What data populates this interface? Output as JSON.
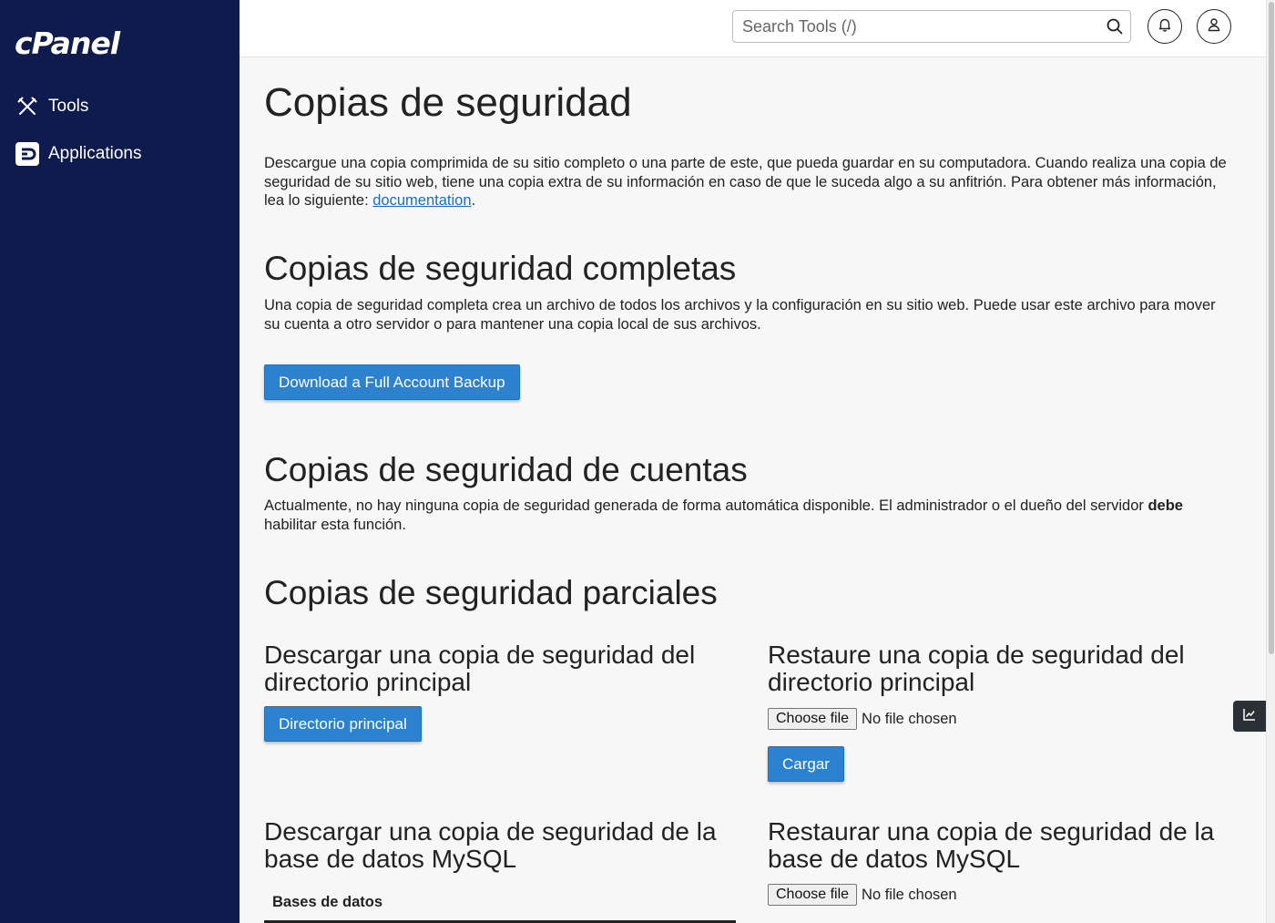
{
  "sidebar": {
    "logo": "cPanel",
    "items": [
      {
        "label": "Tools",
        "icon": "tools-icon"
      },
      {
        "label": "Applications",
        "icon": "applications-icon"
      }
    ]
  },
  "topbar": {
    "search_placeholder": "Search Tools (/)"
  },
  "main": {
    "title": "Copias de seguridad",
    "intro_text": "Descargue una copia comprimida de su sitio completo o una parte de este, que pueda guardar en su computadora. Cuando realiza una copia de seguridad de su sitio web, tiene una copia extra de su información en caso de que le suceda algo a su anfitrión. Para obtener más información, lea lo siguiente: ",
    "intro_link": "documentation",
    "intro_end": ".",
    "full_backup": {
      "heading": "Copias de seguridad completas",
      "text": "Una copia de seguridad completa crea un archivo de todos los archivos y la configuración en su sitio web. Puede usar este archivo para mover su cuenta a otro servidor o para mantener una copia local de sus archivos.",
      "button": "Download a Full Account Backup"
    },
    "account_backups": {
      "heading": "Copias de seguridad de cuentas",
      "text_before": "Actualmente, no hay ninguna copia de seguridad generada de forma automática disponible. El administrador o el dueño del servidor ",
      "text_bold": "debe",
      "text_after": " habilitar esta función."
    },
    "partial_backups": {
      "heading": "Copias de seguridad parciales",
      "download_home_heading": "Descargar una copia de seguridad del directorio principal",
      "download_home_button": "Directorio principal",
      "restore_home_heading": "Restaure una copia de seguridad del directorio principal",
      "choose_file": "Choose file",
      "no_file": "No file chosen",
      "upload_button": "Cargar",
      "download_mysql_heading": "Descargar una copia de seguridad de la base de datos MySQL",
      "databases_column": "Bases de datos",
      "restore_mysql_heading": "Restaurar una copia de seguridad de la base de datos MySQL"
    }
  },
  "colors": {
    "sidebar_bg": "#0f1b4c",
    "accent": "#2d82d0",
    "link": "#1b6fc0"
  }
}
